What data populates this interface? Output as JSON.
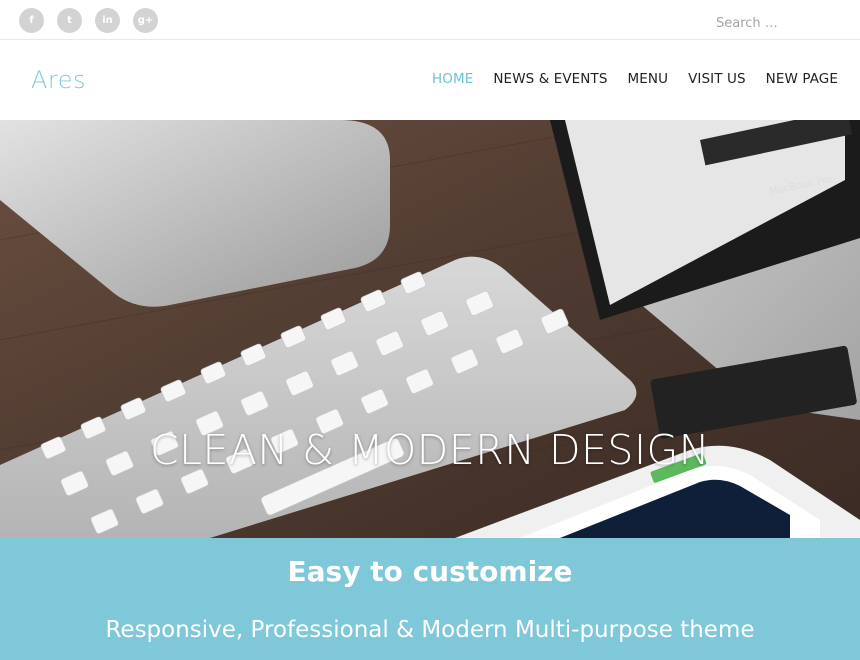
{
  "topbar": {
    "social": [
      {
        "icon": "facebook-icon",
        "glyph": "f"
      },
      {
        "icon": "twitter-icon",
        "glyph": "t"
      },
      {
        "icon": "linkedin-icon",
        "glyph": "in"
      },
      {
        "icon": "google-plus-icon",
        "glyph": "g+"
      }
    ],
    "search_placeholder": "Search …"
  },
  "header": {
    "logo": "Ares",
    "nav": [
      {
        "label": "HOME",
        "active": true
      },
      {
        "label": "NEWS & EVENTS",
        "active": false
      },
      {
        "label": "MENU",
        "active": false
      },
      {
        "label": "VISIT US",
        "active": false
      },
      {
        "label": "NEW PAGE",
        "active": false
      }
    ]
  },
  "hero": {
    "title": "CLEAN & MODERN DESIGN",
    "laptop_label": "MacBook Pro"
  },
  "band": {
    "title": "Easy to customize",
    "subtitle": "Responsive, Professional & Modern Multi-purpose theme"
  },
  "colors": {
    "accent": "#7ec8d9",
    "nav_active": "#6cc0d6",
    "social_bg": "#d3d3d3"
  }
}
